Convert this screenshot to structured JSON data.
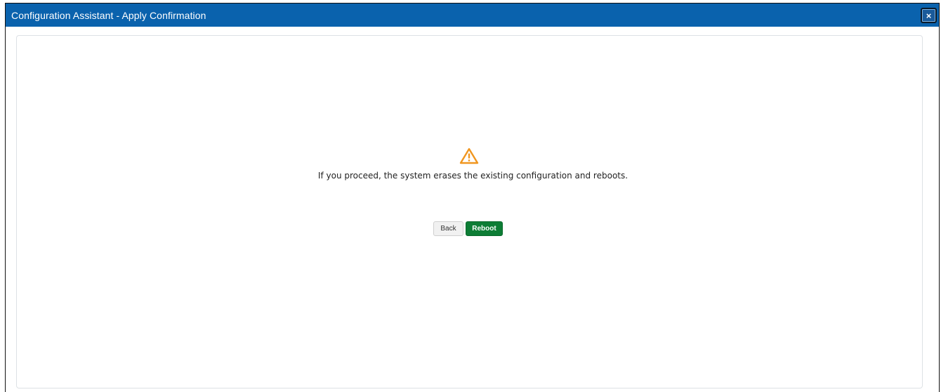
{
  "window": {
    "title": "Configuration Assistant - Apply Confirmation",
    "close_label": "×"
  },
  "dialog": {
    "icon": "warning-triangle-icon",
    "message": "If you proceed, the system erases the existing configuration and reboots."
  },
  "actions": {
    "back_label": "Back",
    "reboot_label": "Reboot"
  },
  "colors": {
    "titlebar": "#0a62ad",
    "warning": "#f0961f",
    "reboot_button": "#0d7d35"
  }
}
